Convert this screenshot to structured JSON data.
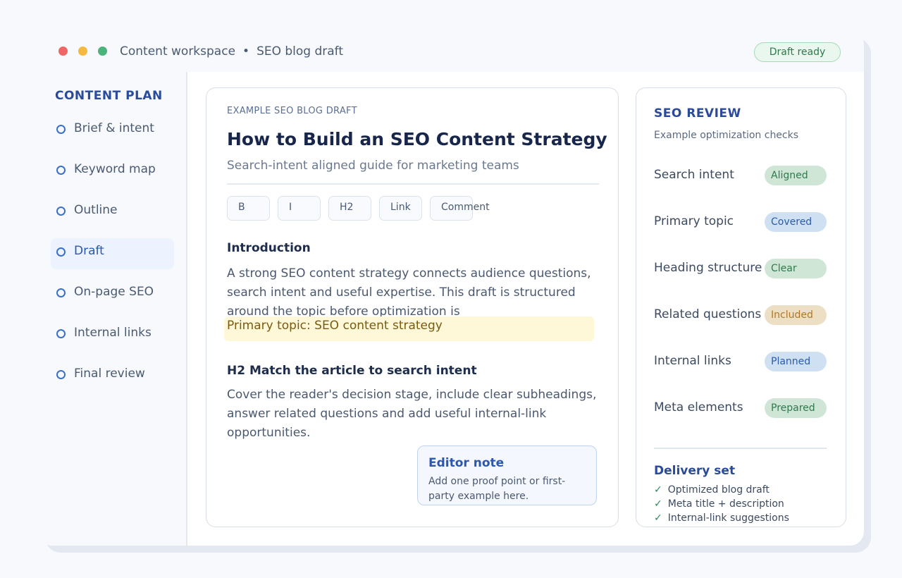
{
  "window": {
    "app_name": "Content workspace",
    "separator": "•",
    "doc_name": "SEO blog draft",
    "status": "Draft ready"
  },
  "sidebar": {
    "heading": "CONTENT PLAN",
    "items": [
      {
        "label": "Brief & intent",
        "active": false
      },
      {
        "label": "Keyword map",
        "active": false
      },
      {
        "label": "Outline",
        "active": false
      },
      {
        "label": "Draft",
        "active": true
      },
      {
        "label": "On-page SEO",
        "active": false
      },
      {
        "label": "Internal links",
        "active": false
      },
      {
        "label": "Final review",
        "active": false
      }
    ]
  },
  "editor": {
    "eyebrow": "EXAMPLE SEO BLOG DRAFT",
    "title": "How to Build an SEO Content Strategy",
    "subtitle": "Search-intent aligned guide for marketing teams",
    "toolbar": [
      "B",
      "I",
      "H2",
      "Link",
      "Comment"
    ],
    "intro_heading": "Introduction",
    "intro_text": "A strong SEO content strategy connects audience questions, search intent and useful expertise. This draft is structured around the topic before optimization is",
    "highlight": "Primary topic: SEO content strategy",
    "h2_heading": "H2  Match the article to search intent",
    "h2_text": "Cover the reader's decision stage, include clear subheadings, answer related questions and add useful internal-link opportunities.",
    "note_title": "Editor note",
    "note_text": "Add one proof point or first-party example here."
  },
  "review": {
    "heading": "SEO REVIEW",
    "subheading": "Example optimization checks",
    "checks": [
      {
        "label": "Search intent",
        "status": "Aligned",
        "bg": "#cfe6d7",
        "fg": "#2e7a4c"
      },
      {
        "label": "Primary topic",
        "status": "Covered",
        "bg": "#cfe0f2",
        "fg": "#2a5ca8"
      },
      {
        "label": "Heading structure",
        "status": "Clear",
        "bg": "#cfe6d7",
        "fg": "#2e7a4c"
      },
      {
        "label": "Related questions",
        "status": "Included",
        "bg": "#ecdfc4",
        "fg": "#b07828"
      },
      {
        "label": "Internal links",
        "status": "Planned",
        "bg": "#cfe0f2",
        "fg": "#2a5ca8"
      },
      {
        "label": "Meta elements",
        "status": "Prepared",
        "bg": "#cfe6d7",
        "fg": "#2e7a4c"
      }
    ],
    "delivery_heading": "Delivery set",
    "delivery_tick": "✓",
    "delivery_items": [
      "Optimized blog draft",
      "Meta title + description",
      "Internal-link suggestions"
    ]
  }
}
